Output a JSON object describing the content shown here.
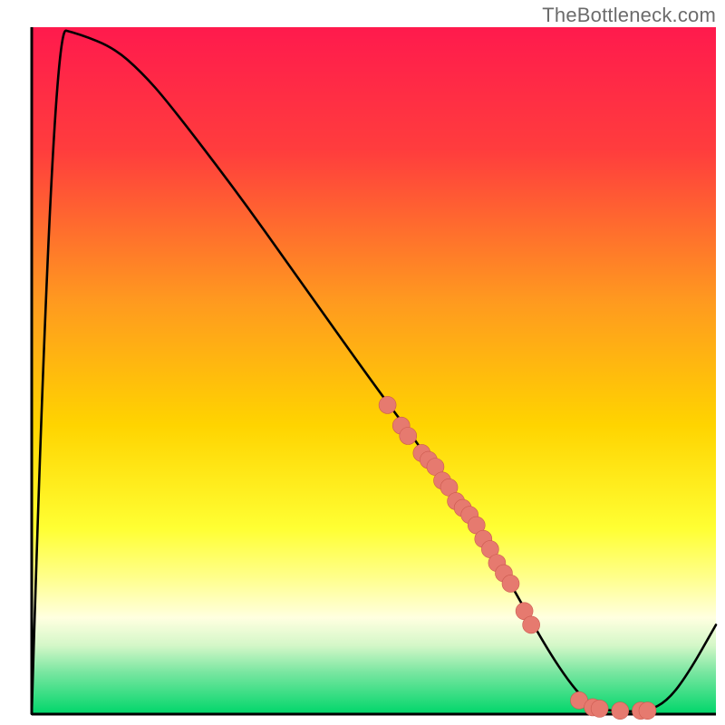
{
  "attribution": "TheBottleneck.com",
  "colors": {
    "curve": "#000000",
    "axis": "#000000",
    "dot_fill": "#e67a6f",
    "dot_stroke": "#cc5a4f",
    "bg_top": "#ff1a4d",
    "bg_mid_orange": "#ffb200",
    "bg_yellow": "#ffff33",
    "bg_pale_yellow": "#ffffcc",
    "bg_mint": "#8fe8a3",
    "bg_green": "#00d66a"
  },
  "chart_data": {
    "type": "line",
    "title": "",
    "xlabel": "",
    "ylabel": "",
    "xlim": [
      0,
      100
    ],
    "ylim": [
      0,
      100
    ],
    "grid": false,
    "legend": false,
    "curve": [
      {
        "x": 0,
        "y": 0
      },
      {
        "x": 3,
        "y": 100
      },
      {
        "x": 7,
        "y": 99
      },
      {
        "x": 12,
        "y": 97
      },
      {
        "x": 16,
        "y": 93.5
      },
      {
        "x": 20,
        "y": 89
      },
      {
        "x": 30,
        "y": 76
      },
      {
        "x": 40,
        "y": 62
      },
      {
        "x": 50,
        "y": 48
      },
      {
        "x": 56,
        "y": 40
      },
      {
        "x": 60,
        "y": 34
      },
      {
        "x": 64,
        "y": 29
      },
      {
        "x": 70,
        "y": 19
      },
      {
        "x": 75,
        "y": 10
      },
      {
        "x": 79,
        "y": 4
      },
      {
        "x": 82,
        "y": 1
      },
      {
        "x": 85,
        "y": 0.4
      },
      {
        "x": 90,
        "y": 0.4
      },
      {
        "x": 93,
        "y": 2
      },
      {
        "x": 96,
        "y": 6
      },
      {
        "x": 100,
        "y": 13
      }
    ],
    "scatter": [
      {
        "x": 52,
        "y": 45
      },
      {
        "x": 54,
        "y": 42
      },
      {
        "x": 55,
        "y": 40.5
      },
      {
        "x": 57,
        "y": 38
      },
      {
        "x": 58,
        "y": 37
      },
      {
        "x": 59,
        "y": 36
      },
      {
        "x": 60,
        "y": 34
      },
      {
        "x": 61,
        "y": 33
      },
      {
        "x": 62,
        "y": 31
      },
      {
        "x": 63,
        "y": 30
      },
      {
        "x": 64,
        "y": 29
      },
      {
        "x": 65,
        "y": 27.5
      },
      {
        "x": 66,
        "y": 25.5
      },
      {
        "x": 67,
        "y": 24
      },
      {
        "x": 68,
        "y": 22
      },
      {
        "x": 69,
        "y": 20.5
      },
      {
        "x": 70,
        "y": 19
      },
      {
        "x": 72,
        "y": 15
      },
      {
        "x": 73,
        "y": 13
      },
      {
        "x": 80,
        "y": 2
      },
      {
        "x": 82,
        "y": 1
      },
      {
        "x": 83,
        "y": 0.8
      },
      {
        "x": 86,
        "y": 0.5
      },
      {
        "x": 89,
        "y": 0.5
      },
      {
        "x": 90,
        "y": 0.5
      }
    ],
    "gradient_stops": [
      {
        "offset": 0.0,
        "color": "#ff1a4d"
      },
      {
        "offset": 0.18,
        "color": "#ff3d3d"
      },
      {
        "offset": 0.4,
        "color": "#ff9a1f"
      },
      {
        "offset": 0.58,
        "color": "#ffd400"
      },
      {
        "offset": 0.73,
        "color": "#ffff33"
      },
      {
        "offset": 0.8,
        "color": "#ffff8a"
      },
      {
        "offset": 0.86,
        "color": "#ffffe0"
      },
      {
        "offset": 0.9,
        "color": "#d4f7c8"
      },
      {
        "offset": 0.94,
        "color": "#77e6a0"
      },
      {
        "offset": 1.0,
        "color": "#00d66a"
      }
    ],
    "dot_radius": 9.5
  }
}
